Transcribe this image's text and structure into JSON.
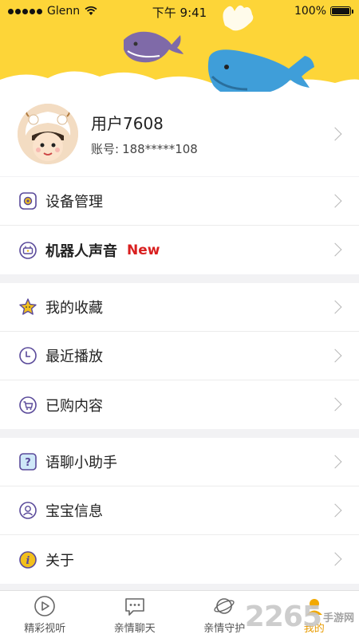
{
  "status_bar": {
    "carrier": "Glenn",
    "time": "下午 9:41",
    "battery": "100%"
  },
  "profile": {
    "username": "用户7608",
    "account_label": "账号:",
    "account_value": "188*****108"
  },
  "group1": [
    {
      "label": "设备管理",
      "icon": "gear-icon"
    },
    {
      "label": "机器人声音",
      "badge": "New",
      "icon": "robot-icon"
    }
  ],
  "group2": [
    {
      "label": "我的收藏",
      "icon": "star-icon"
    },
    {
      "label": "最近播放",
      "icon": "clock-icon"
    },
    {
      "label": "已购内容",
      "icon": "cart-icon"
    }
  ],
  "group3": [
    {
      "label": "语聊小助手",
      "icon": "question-icon"
    },
    {
      "label": "宝宝信息",
      "icon": "person-icon"
    },
    {
      "label": "关于",
      "icon": "info-icon"
    }
  ],
  "tabs": [
    {
      "label": "精彩视听",
      "icon": "play-icon"
    },
    {
      "label": "亲情聊天",
      "icon": "chat-icon"
    },
    {
      "label": "亲情守护",
      "icon": "planet-icon"
    },
    {
      "label": "我的",
      "icon": "me-icon"
    }
  ],
  "watermark": {
    "number": "2265",
    "text": "手游网"
  },
  "colors": {
    "header": "#fdd538",
    "badge": "#d91f1f",
    "active_tab": "#e89b00",
    "icon_purple": "#5a4a9a"
  }
}
